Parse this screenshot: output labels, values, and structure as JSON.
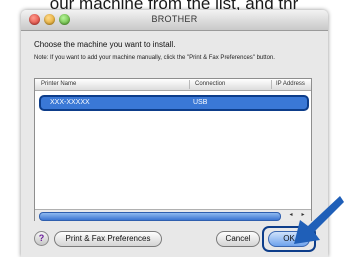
{
  "caption": {
    "text": "our machine from the list, and thr"
  },
  "window": {
    "title": "BROTHER",
    "heading": "Choose the machine you want to install.",
    "note": "Note: If you want to add your machine manually, click the \"Print & Fax Preferences\" button."
  },
  "device_list": {
    "columns": [
      "Printer Name",
      "Connection",
      "IP Address"
    ],
    "rows": [
      {
        "name": "XXX-XXXXX",
        "connection": "USB",
        "selected": true
      }
    ]
  },
  "buttons": {
    "help": "?",
    "print_fax": "Print & Fax Preferences",
    "cancel": "Cancel",
    "ok": "OK"
  },
  "colors": {
    "selection": "#3a78d6",
    "highlight_outline": "#0d3d8a",
    "pointer_arrow": "#1f5fb8"
  },
  "icons": {
    "pointer": "arrow-pointer-icon",
    "help": "help-icon"
  }
}
